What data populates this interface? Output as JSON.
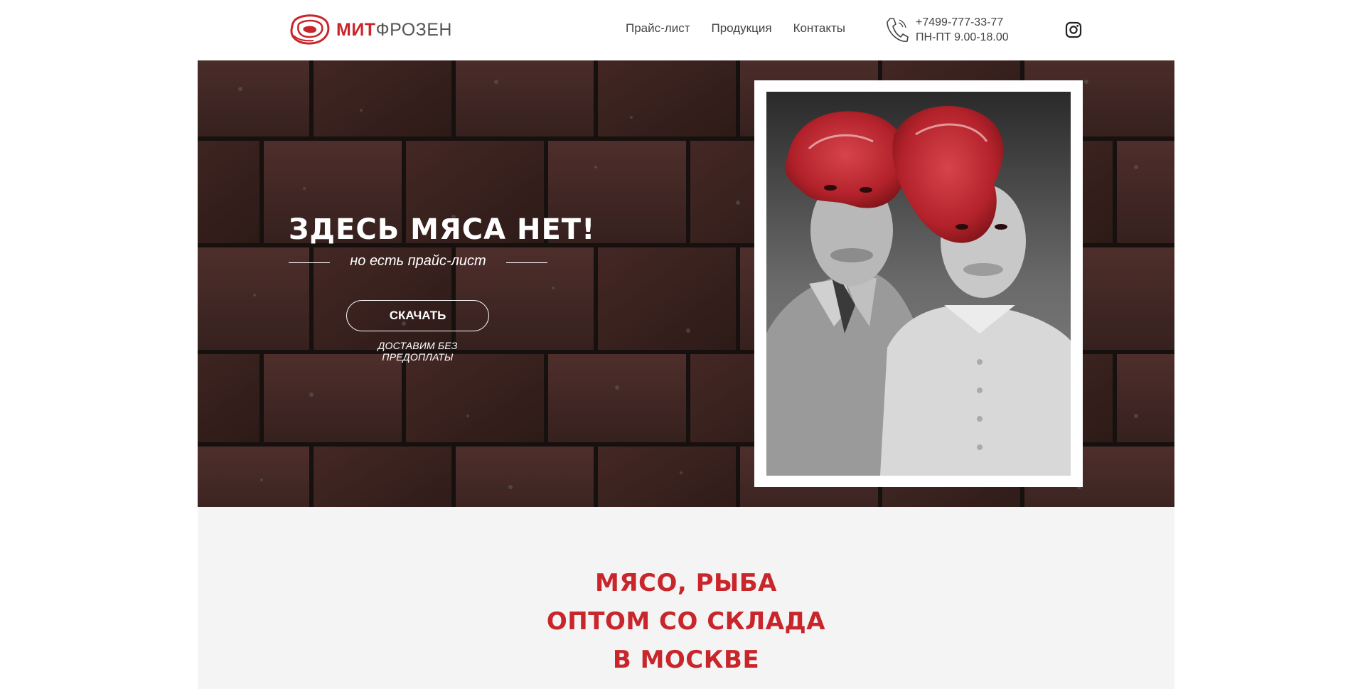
{
  "logo": {
    "part1": "МИТ",
    "part2": "ФРОЗЕН",
    "brand_color": "#c8262b"
  },
  "nav": {
    "items": [
      {
        "label": "Прайс-лист"
      },
      {
        "label": "Продукция"
      },
      {
        "label": "Контакты"
      }
    ]
  },
  "contact": {
    "phone": "+7499-777-33-77",
    "hours": "ПН-ПТ 9.00-18.00"
  },
  "icons": {
    "phone": "phone-icon",
    "instagram": "instagram-icon",
    "logo": "meat-steak-icon"
  },
  "hero": {
    "title": "ЗДЕСЬ МЯСА НЕТ!",
    "subtitle": "но есть прайс-лист",
    "button_label": "СКАЧАТЬ",
    "note": "ДОСТАВИМ БЕЗ ПРЕДОПЛАТЫ"
  },
  "lower": {
    "lines": [
      "МЯСО, РЫБА",
      "ОПТОМ СО СКЛАДА",
      "В МОСКВЕ"
    ]
  }
}
